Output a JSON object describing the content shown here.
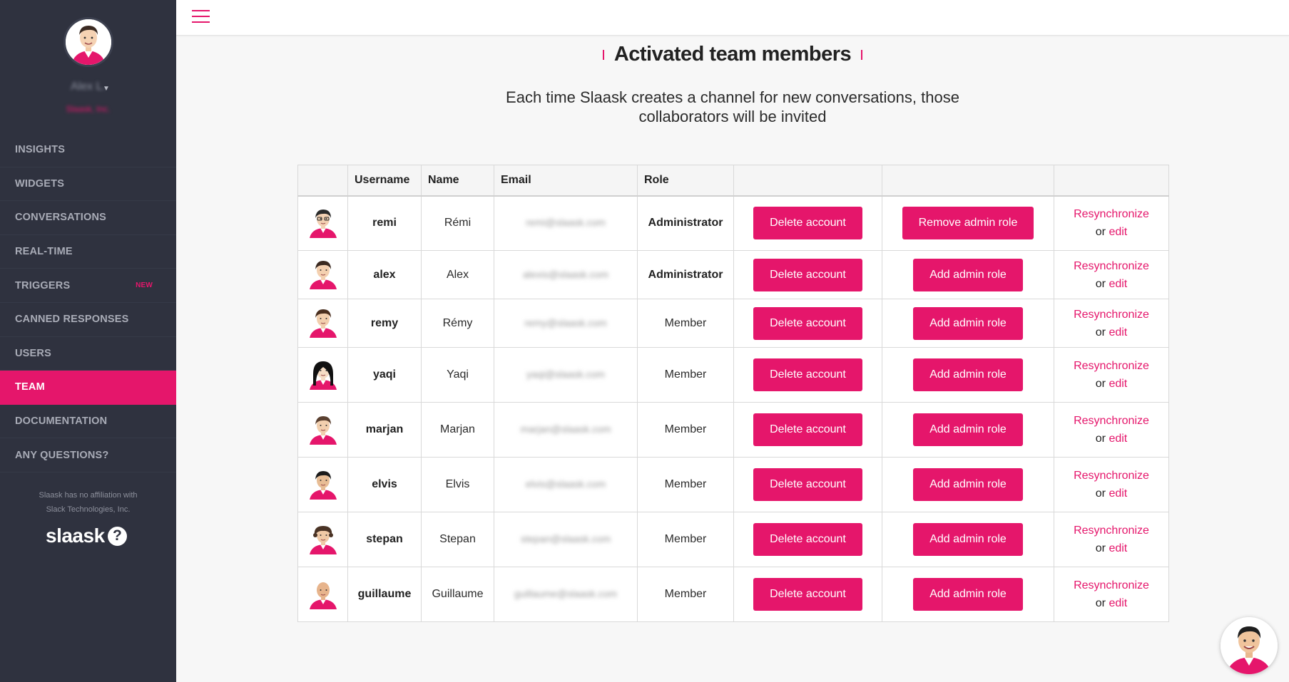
{
  "sidebar": {
    "user_name": "Alex L.",
    "user_company": "Slaask, Inc.",
    "items": [
      {
        "label": "INSIGHTS",
        "badge": ""
      },
      {
        "label": "WIDGETS",
        "badge": ""
      },
      {
        "label": "CONVERSATIONS",
        "badge": ""
      },
      {
        "label": "REAL-TIME",
        "badge": ""
      },
      {
        "label": "TRIGGERS",
        "badge": "NEW"
      },
      {
        "label": "CANNED RESPONSES",
        "badge": ""
      },
      {
        "label": "USERS",
        "badge": ""
      },
      {
        "label": "TEAM",
        "badge": ""
      },
      {
        "label": "DOCUMENTATION",
        "badge": ""
      },
      {
        "label": "ANY QUESTIONS?",
        "badge": ""
      }
    ],
    "active_item": "TEAM",
    "affiliation": "Slaask has no affiliation with Slack Technologies, Inc.",
    "logo_text": "slaask",
    "logo_mark": "?"
  },
  "page": {
    "title": "Activated team members",
    "subtitle_line1": "Each time Slaask creates a channel for new conversations, those",
    "subtitle_line2": "collaborators will be invited"
  },
  "table": {
    "headers": [
      "",
      "Username",
      "Name",
      "Email",
      "Role",
      "",
      "",
      ""
    ],
    "rows": [
      {
        "username": "remi",
        "name": "Rémi",
        "email": "remi@slaask.com",
        "role": "Administrator",
        "delete_label": "Delete account",
        "admin_label": "Remove admin role",
        "sync_label": "Resynchronize",
        "or_label": "or",
        "edit_label": "edit"
      },
      {
        "username": "alex",
        "name": "Alex",
        "email": "alexis@slaask.com",
        "role": "Administrator",
        "delete_label": "Delete account",
        "admin_label": "Add admin role",
        "sync_label": "Resynchronize",
        "or_label": "or",
        "edit_label": "edit"
      },
      {
        "username": "remy",
        "name": "Rémy",
        "email": "remy@slaask.com",
        "role": "Member",
        "delete_label": "Delete account",
        "admin_label": "Add admin role",
        "sync_label": "Resynchronize",
        "or_label": "or",
        "edit_label": "edit"
      },
      {
        "username": "yaqi",
        "name": "Yaqi",
        "email": "yaqi@slaask.com",
        "role": "Member",
        "delete_label": "Delete account",
        "admin_label": "Add admin role",
        "sync_label": "Resynchronize",
        "or_label": "or",
        "edit_label": "edit"
      },
      {
        "username": "marjan",
        "name": "Marjan",
        "email": "marjan@slaask.com",
        "role": "Member",
        "delete_label": "Delete account",
        "admin_label": "Add admin role",
        "sync_label": "Resynchronize",
        "or_label": "or",
        "edit_label": "edit"
      },
      {
        "username": "elvis",
        "name": "Elvis",
        "email": "elvis@slaask.com",
        "role": "Member",
        "delete_label": "Delete account",
        "admin_label": "Add admin role",
        "sync_label": "Resynchronize",
        "or_label": "or",
        "edit_label": "edit"
      },
      {
        "username": "stepan",
        "name": "Stepan",
        "email": "stepan@slaask.com",
        "role": "Member",
        "delete_label": "Delete account",
        "admin_label": "Add admin role",
        "sync_label": "Resynchronize",
        "or_label": "or",
        "edit_label": "edit"
      },
      {
        "username": "guillaume",
        "name": "Guillaume",
        "email": "guillaume@slaask.com",
        "role": "Member",
        "delete_label": "Delete account",
        "admin_label": "Add admin role",
        "sync_label": "Resynchronize",
        "or_label": "or",
        "edit_label": "edit"
      }
    ]
  },
  "colors": {
    "accent": "#e5166b",
    "sidebar_bg": "#2f323f",
    "page_bg": "#f7f7f7"
  },
  "icons": {
    "menu": "hamburger-icon",
    "chat": "chat-avatar-icon",
    "caret": "caret-down-icon"
  }
}
